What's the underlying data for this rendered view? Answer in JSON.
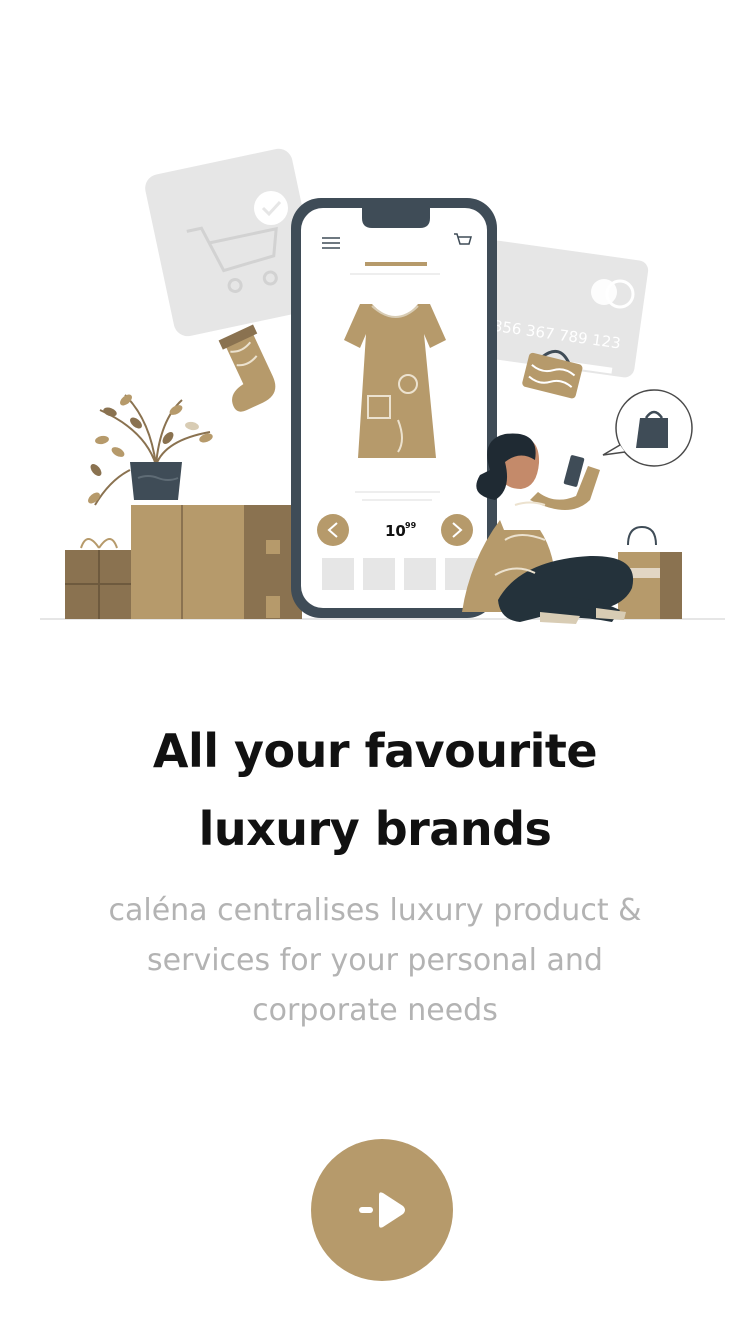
{
  "illustration": {
    "label": "Shopping online illustration",
    "phone_price": "10",
    "phone_price_cents": "99",
    "card_number": "356 367 789 123",
    "colors": {
      "gold": "#b69a6b",
      "dark": "#3f4c57",
      "light": "#e7e7e7"
    }
  },
  "onboarding": {
    "title_line1": "All your favourite",
    "title_line2": "luxury brands",
    "subtitle_line1": "caléna centralises luxury product &",
    "subtitle_line2": "services for your personal and",
    "subtitle_line3": "corporate needs"
  },
  "next_button": {
    "icon": "arrow-right-icon",
    "color": "#b69a6b"
  }
}
